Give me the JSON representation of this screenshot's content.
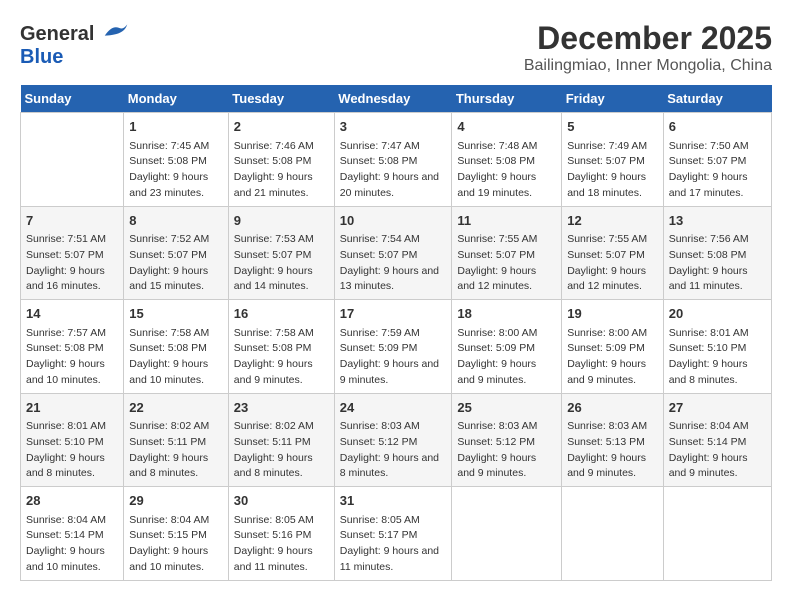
{
  "logo": {
    "general": "General",
    "blue": "Blue"
  },
  "title": "December 2025",
  "subtitle": "Bailingmiao, Inner Mongolia, China",
  "days_header": [
    "Sunday",
    "Monday",
    "Tuesday",
    "Wednesday",
    "Thursday",
    "Friday",
    "Saturday"
  ],
  "weeks": [
    [
      {
        "day": "",
        "sunrise": "",
        "sunset": "",
        "daylight": ""
      },
      {
        "day": "1",
        "sunrise": "Sunrise: 7:45 AM",
        "sunset": "Sunset: 5:08 PM",
        "daylight": "Daylight: 9 hours and 23 minutes."
      },
      {
        "day": "2",
        "sunrise": "Sunrise: 7:46 AM",
        "sunset": "Sunset: 5:08 PM",
        "daylight": "Daylight: 9 hours and 21 minutes."
      },
      {
        "day": "3",
        "sunrise": "Sunrise: 7:47 AM",
        "sunset": "Sunset: 5:08 PM",
        "daylight": "Daylight: 9 hours and 20 minutes."
      },
      {
        "day": "4",
        "sunrise": "Sunrise: 7:48 AM",
        "sunset": "Sunset: 5:08 PM",
        "daylight": "Daylight: 9 hours and 19 minutes."
      },
      {
        "day": "5",
        "sunrise": "Sunrise: 7:49 AM",
        "sunset": "Sunset: 5:07 PM",
        "daylight": "Daylight: 9 hours and 18 minutes."
      },
      {
        "day": "6",
        "sunrise": "Sunrise: 7:50 AM",
        "sunset": "Sunset: 5:07 PM",
        "daylight": "Daylight: 9 hours and 17 minutes."
      }
    ],
    [
      {
        "day": "7",
        "sunrise": "Sunrise: 7:51 AM",
        "sunset": "Sunset: 5:07 PM",
        "daylight": "Daylight: 9 hours and 16 minutes."
      },
      {
        "day": "8",
        "sunrise": "Sunrise: 7:52 AM",
        "sunset": "Sunset: 5:07 PM",
        "daylight": "Daylight: 9 hours and 15 minutes."
      },
      {
        "day": "9",
        "sunrise": "Sunrise: 7:53 AM",
        "sunset": "Sunset: 5:07 PM",
        "daylight": "Daylight: 9 hours and 14 minutes."
      },
      {
        "day": "10",
        "sunrise": "Sunrise: 7:54 AM",
        "sunset": "Sunset: 5:07 PM",
        "daylight": "Daylight: 9 hours and 13 minutes."
      },
      {
        "day": "11",
        "sunrise": "Sunrise: 7:55 AM",
        "sunset": "Sunset: 5:07 PM",
        "daylight": "Daylight: 9 hours and 12 minutes."
      },
      {
        "day": "12",
        "sunrise": "Sunrise: 7:55 AM",
        "sunset": "Sunset: 5:07 PM",
        "daylight": "Daylight: 9 hours and 12 minutes."
      },
      {
        "day": "13",
        "sunrise": "Sunrise: 7:56 AM",
        "sunset": "Sunset: 5:08 PM",
        "daylight": "Daylight: 9 hours and 11 minutes."
      }
    ],
    [
      {
        "day": "14",
        "sunrise": "Sunrise: 7:57 AM",
        "sunset": "Sunset: 5:08 PM",
        "daylight": "Daylight: 9 hours and 10 minutes."
      },
      {
        "day": "15",
        "sunrise": "Sunrise: 7:58 AM",
        "sunset": "Sunset: 5:08 PM",
        "daylight": "Daylight: 9 hours and 10 minutes."
      },
      {
        "day": "16",
        "sunrise": "Sunrise: 7:58 AM",
        "sunset": "Sunset: 5:08 PM",
        "daylight": "Daylight: 9 hours and 9 minutes."
      },
      {
        "day": "17",
        "sunrise": "Sunrise: 7:59 AM",
        "sunset": "Sunset: 5:09 PM",
        "daylight": "Daylight: 9 hours and 9 minutes."
      },
      {
        "day": "18",
        "sunrise": "Sunrise: 8:00 AM",
        "sunset": "Sunset: 5:09 PM",
        "daylight": "Daylight: 9 hours and 9 minutes."
      },
      {
        "day": "19",
        "sunrise": "Sunrise: 8:00 AM",
        "sunset": "Sunset: 5:09 PM",
        "daylight": "Daylight: 9 hours and 9 minutes."
      },
      {
        "day": "20",
        "sunrise": "Sunrise: 8:01 AM",
        "sunset": "Sunset: 5:10 PM",
        "daylight": "Daylight: 9 hours and 8 minutes."
      }
    ],
    [
      {
        "day": "21",
        "sunrise": "Sunrise: 8:01 AM",
        "sunset": "Sunset: 5:10 PM",
        "daylight": "Daylight: 9 hours and 8 minutes."
      },
      {
        "day": "22",
        "sunrise": "Sunrise: 8:02 AM",
        "sunset": "Sunset: 5:11 PM",
        "daylight": "Daylight: 9 hours and 8 minutes."
      },
      {
        "day": "23",
        "sunrise": "Sunrise: 8:02 AM",
        "sunset": "Sunset: 5:11 PM",
        "daylight": "Daylight: 9 hours and 8 minutes."
      },
      {
        "day": "24",
        "sunrise": "Sunrise: 8:03 AM",
        "sunset": "Sunset: 5:12 PM",
        "daylight": "Daylight: 9 hours and 8 minutes."
      },
      {
        "day": "25",
        "sunrise": "Sunrise: 8:03 AM",
        "sunset": "Sunset: 5:12 PM",
        "daylight": "Daylight: 9 hours and 9 minutes."
      },
      {
        "day": "26",
        "sunrise": "Sunrise: 8:03 AM",
        "sunset": "Sunset: 5:13 PM",
        "daylight": "Daylight: 9 hours and 9 minutes."
      },
      {
        "day": "27",
        "sunrise": "Sunrise: 8:04 AM",
        "sunset": "Sunset: 5:14 PM",
        "daylight": "Daylight: 9 hours and 9 minutes."
      }
    ],
    [
      {
        "day": "28",
        "sunrise": "Sunrise: 8:04 AM",
        "sunset": "Sunset: 5:14 PM",
        "daylight": "Daylight: 9 hours and 10 minutes."
      },
      {
        "day": "29",
        "sunrise": "Sunrise: 8:04 AM",
        "sunset": "Sunset: 5:15 PM",
        "daylight": "Daylight: 9 hours and 10 minutes."
      },
      {
        "day": "30",
        "sunrise": "Sunrise: 8:05 AM",
        "sunset": "Sunset: 5:16 PM",
        "daylight": "Daylight: 9 hours and 11 minutes."
      },
      {
        "day": "31",
        "sunrise": "Sunrise: 8:05 AM",
        "sunset": "Sunset: 5:17 PM",
        "daylight": "Daylight: 9 hours and 11 minutes."
      },
      {
        "day": "",
        "sunrise": "",
        "sunset": "",
        "daylight": ""
      },
      {
        "day": "",
        "sunrise": "",
        "sunset": "",
        "daylight": ""
      },
      {
        "day": "",
        "sunrise": "",
        "sunset": "",
        "daylight": ""
      }
    ]
  ]
}
